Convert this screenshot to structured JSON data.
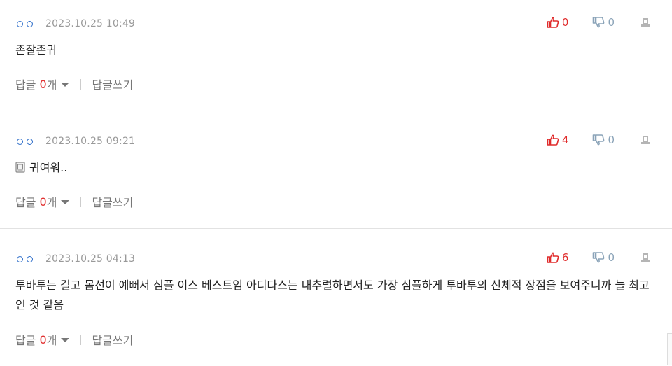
{
  "comments": [
    {
      "date": "2023.10.25 10:49",
      "text": "존잘존귀",
      "likes": "0",
      "dislikes": "0",
      "reply_prefix": "답글 ",
      "reply_count": "0",
      "reply_suffix": "개",
      "write_reply": "답글쓰기"
    },
    {
      "date": "2023.10.25 09:21",
      "text": "귀여워..",
      "likes": "4",
      "dislikes": "0",
      "reply_prefix": "답글 ",
      "reply_count": "0",
      "reply_suffix": "개",
      "write_reply": "답글쓰기"
    },
    {
      "date": "2023.10.25 04:13",
      "text": "투바투는 길고 몸선이 예뻐서 심플 이스 베스트임 아디다스는 내추럴하면서도 가장 심플하게 투바투의 신체적 장점을 보여주니까 늘 최고인 것 같음",
      "likes": "6",
      "dislikes": "0",
      "reply_prefix": "답글 ",
      "reply_count": "0",
      "reply_suffix": "개",
      "write_reply": "답글쓰기"
    }
  ],
  "colors": {
    "like": "#e02b2b",
    "dislike": "#8aa3b8",
    "user_dot": "#2a6bc9",
    "date": "#999999"
  },
  "icons": {
    "like": "thumbs-up-icon",
    "dislike": "thumbs-down-icon",
    "report": "report-icon",
    "user": "masked-user-icon",
    "attachment": "sticker-icon",
    "dropdown": "caret-down-icon"
  }
}
